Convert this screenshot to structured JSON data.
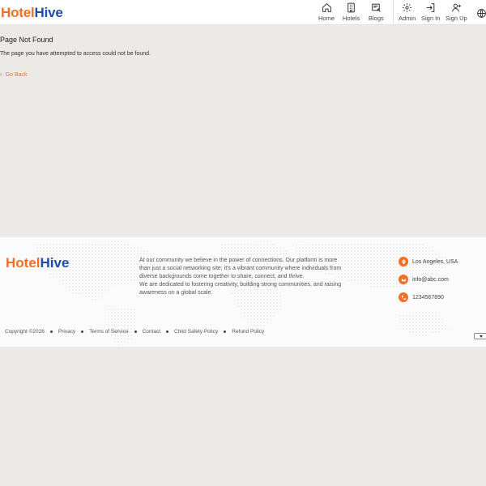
{
  "brand": {
    "part1": "Hotel",
    "part2": "Hive"
  },
  "nav": {
    "items": [
      {
        "label": "Home",
        "icon": "home-icon"
      },
      {
        "label": "Hotels",
        "icon": "building-icon"
      },
      {
        "label": "Blogs",
        "icon": "blog-icon"
      },
      {
        "label": "Admin",
        "icon": "gear-icon"
      },
      {
        "label": "Sign In",
        "icon": "sign-in-icon"
      },
      {
        "label": "Sign Up",
        "icon": "user-plus-icon"
      }
    ],
    "language_icon": "globe-icon"
  },
  "main": {
    "title": "Page Not Found",
    "message": "The page you have attempted to access could not be found.",
    "back_label": "Go Back"
  },
  "footer": {
    "about_1": "At our community we believe in the power of connections. Our platform is more than just a social networking site; it's a vibrant community where individuals from diverse backgrounds come together to share, connect, and thrive.",
    "about_2": "We are dedicated to fostering creativity, building strong communities, and raising awareness on a global scale.",
    "contact": {
      "location": "Los Angeles, USA",
      "email": "info@abc.com",
      "phone": "1234567890"
    },
    "copyright": "Copyright ©2026",
    "links": {
      "privacy": "Privacy",
      "terms": "Terms of Service",
      "contact": "Contact",
      "child_safety": "Child Safety Policy",
      "refund": "Refund Policy"
    }
  },
  "colors": {
    "accent": "#f36f21",
    "brand_blue": "#1d4fa8",
    "page_bg": "#ebeae6",
    "footer_bg": "#fbfbfb"
  }
}
